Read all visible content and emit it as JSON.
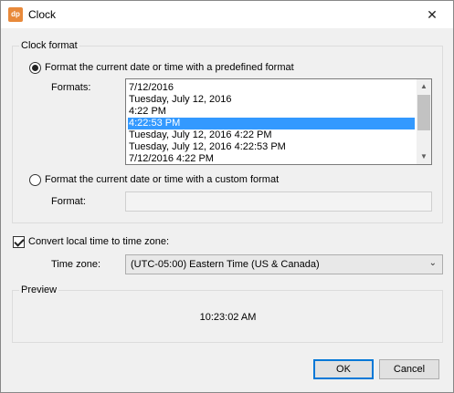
{
  "window": {
    "icon_text": "dp",
    "title": "Clock",
    "close_glyph": "✕"
  },
  "clock_format": {
    "group_label": "Clock format",
    "predefined_option": "Format the current date or time with a predefined format",
    "predefined_selected": true,
    "formats_label": "Formats:",
    "formats": [
      "7/12/2016",
      "Tuesday, July 12, 2016",
      "4:22 PM",
      "4:22:53 PM",
      "Tuesday, July 12, 2016 4:22 PM",
      "Tuesday, July 12, 2016 4:22:53 PM",
      "7/12/2016 4:22 PM"
    ],
    "selected_format": "4:22:53 PM",
    "custom_option": "Format the current date or time with a custom format",
    "custom_selected": false,
    "format_label": "Format:",
    "format_value": ""
  },
  "timezone": {
    "convert_label": "Convert local time to time zone:",
    "convert_checked": true,
    "timezone_label": "Time zone:",
    "timezone_value": "(UTC-05:00) Eastern Time (US & Canada)"
  },
  "preview": {
    "group_label": "Preview",
    "value": "10:23:02 AM"
  },
  "buttons": {
    "ok": "OK",
    "cancel": "Cancel"
  },
  "icons": {
    "scroll_up": "chevron-up-icon",
    "scroll_down": "chevron-down-icon",
    "dropdown": "chevron-down-icon",
    "app": "app-icon",
    "close": "close-icon"
  },
  "colors": {
    "selection": "#3399ff",
    "default_button_border": "#0078d7",
    "app_icon": "#e8893a"
  }
}
